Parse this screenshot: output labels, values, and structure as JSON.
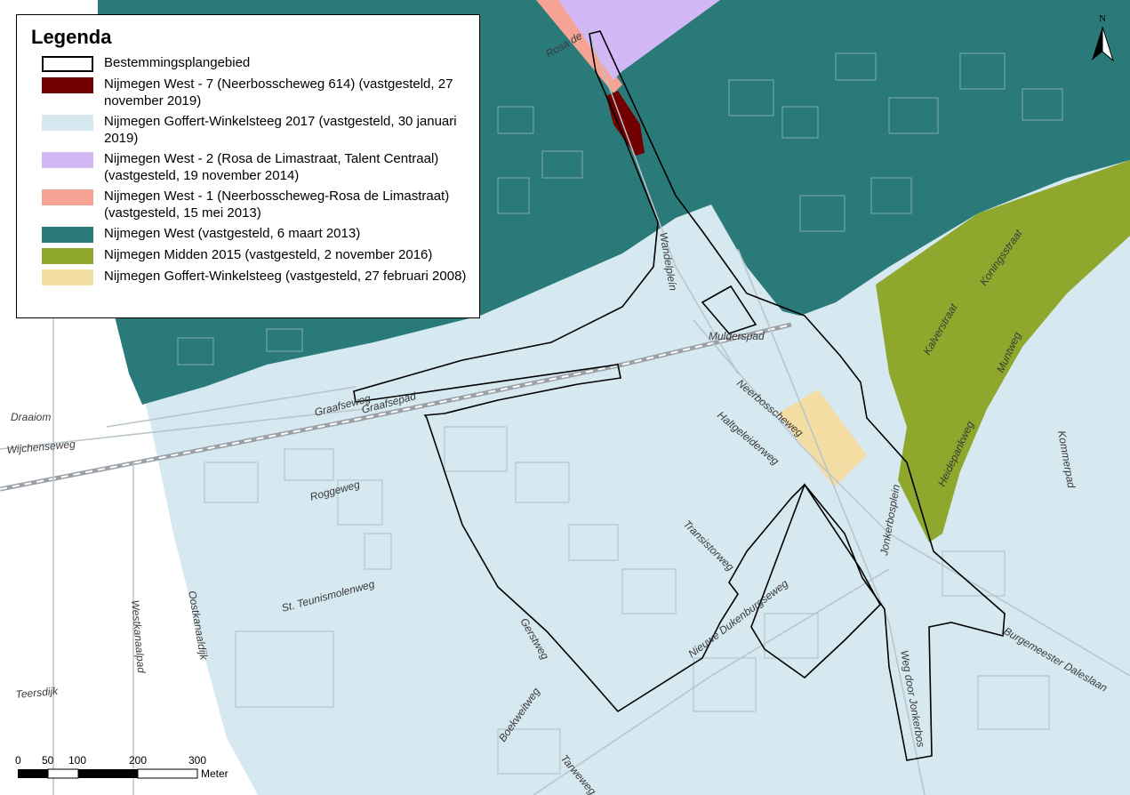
{
  "legend": {
    "title": "Legenda",
    "items": [
      {
        "label": "Bestemmingsplangebied",
        "color": "#ffffff",
        "outline": true
      },
      {
        "label": "Nijmegen West - 7 (Neerbosscheweg 614) (vastgesteld, 27 november 2019)",
        "color": "#730000"
      },
      {
        "label": "Nijmegen Goffert-Winkelsteeg 2017 (vastgesteld, 30 januari 2019)",
        "color": "#d6e8f0"
      },
      {
        "label": "Nijmegen West - 2 (Rosa de Limastraat, Talent Centraal) (vastgesteld, 19 november 2014)",
        "color": "#d2b8f4"
      },
      {
        "label": "Nijmegen West - 1 (Neerbosscheweg-Rosa de Limastraat) (vastgesteld, 15 mei 2013)",
        "color": "#f6a394"
      },
      {
        "label": "Nijmegen West (vastgesteld, 6 maart 2013)",
        "color": "#2b7a7a"
      },
      {
        "label": "Nijmegen Midden 2015 (vastgesteld, 2 november 2016)",
        "color": "#8ea72c"
      },
      {
        "label": "Nijmegen Goffert-Winkelsteeg (vastgesteld, 27 februari 2008)",
        "color": "#f4dda3"
      }
    ]
  },
  "north_arrow": {
    "letter": "N"
  },
  "scale_bar": {
    "ticks": [
      "0",
      "50",
      "100",
      "200",
      "300"
    ],
    "unit": "Meter"
  },
  "streets": [
    {
      "name": "Wandelpleín"
    },
    {
      "name": "Mulderspad"
    },
    {
      "name": "Graafseweg"
    },
    {
      "name": "Graafsepad"
    },
    {
      "name": "Draaiom"
    },
    {
      "name": "Wijchenseweg"
    },
    {
      "name": "Neerbosscheweg"
    },
    {
      "name": "Haltgeleiderweg"
    },
    {
      "name": "Roggeweg"
    },
    {
      "name": "Transistorweg"
    },
    {
      "name": "St. Teunismolenweg"
    },
    {
      "name": "Nieuwe Dukenburgseweg"
    },
    {
      "name": "Oostkanaaldijk"
    },
    {
      "name": "Westkanaalpad"
    },
    {
      "name": "Teersdijk"
    },
    {
      "name": "Gerstweg"
    },
    {
      "name": "Boekweitweg"
    },
    {
      "name": "Tarweweg"
    },
    {
      "name": "Jonkerbosplein"
    },
    {
      "name": "Weg door Jonkerbos"
    },
    {
      "name": "Burgemeester Daleslaan"
    },
    {
      "name": "Kommerpad"
    },
    {
      "name": "Heidepankweg"
    },
    {
      "name": "Muntweg"
    },
    {
      "name": "Koningsstraat"
    },
    {
      "name": "Kalverstraat"
    },
    {
      "name": "Rosa de"
    }
  ]
}
